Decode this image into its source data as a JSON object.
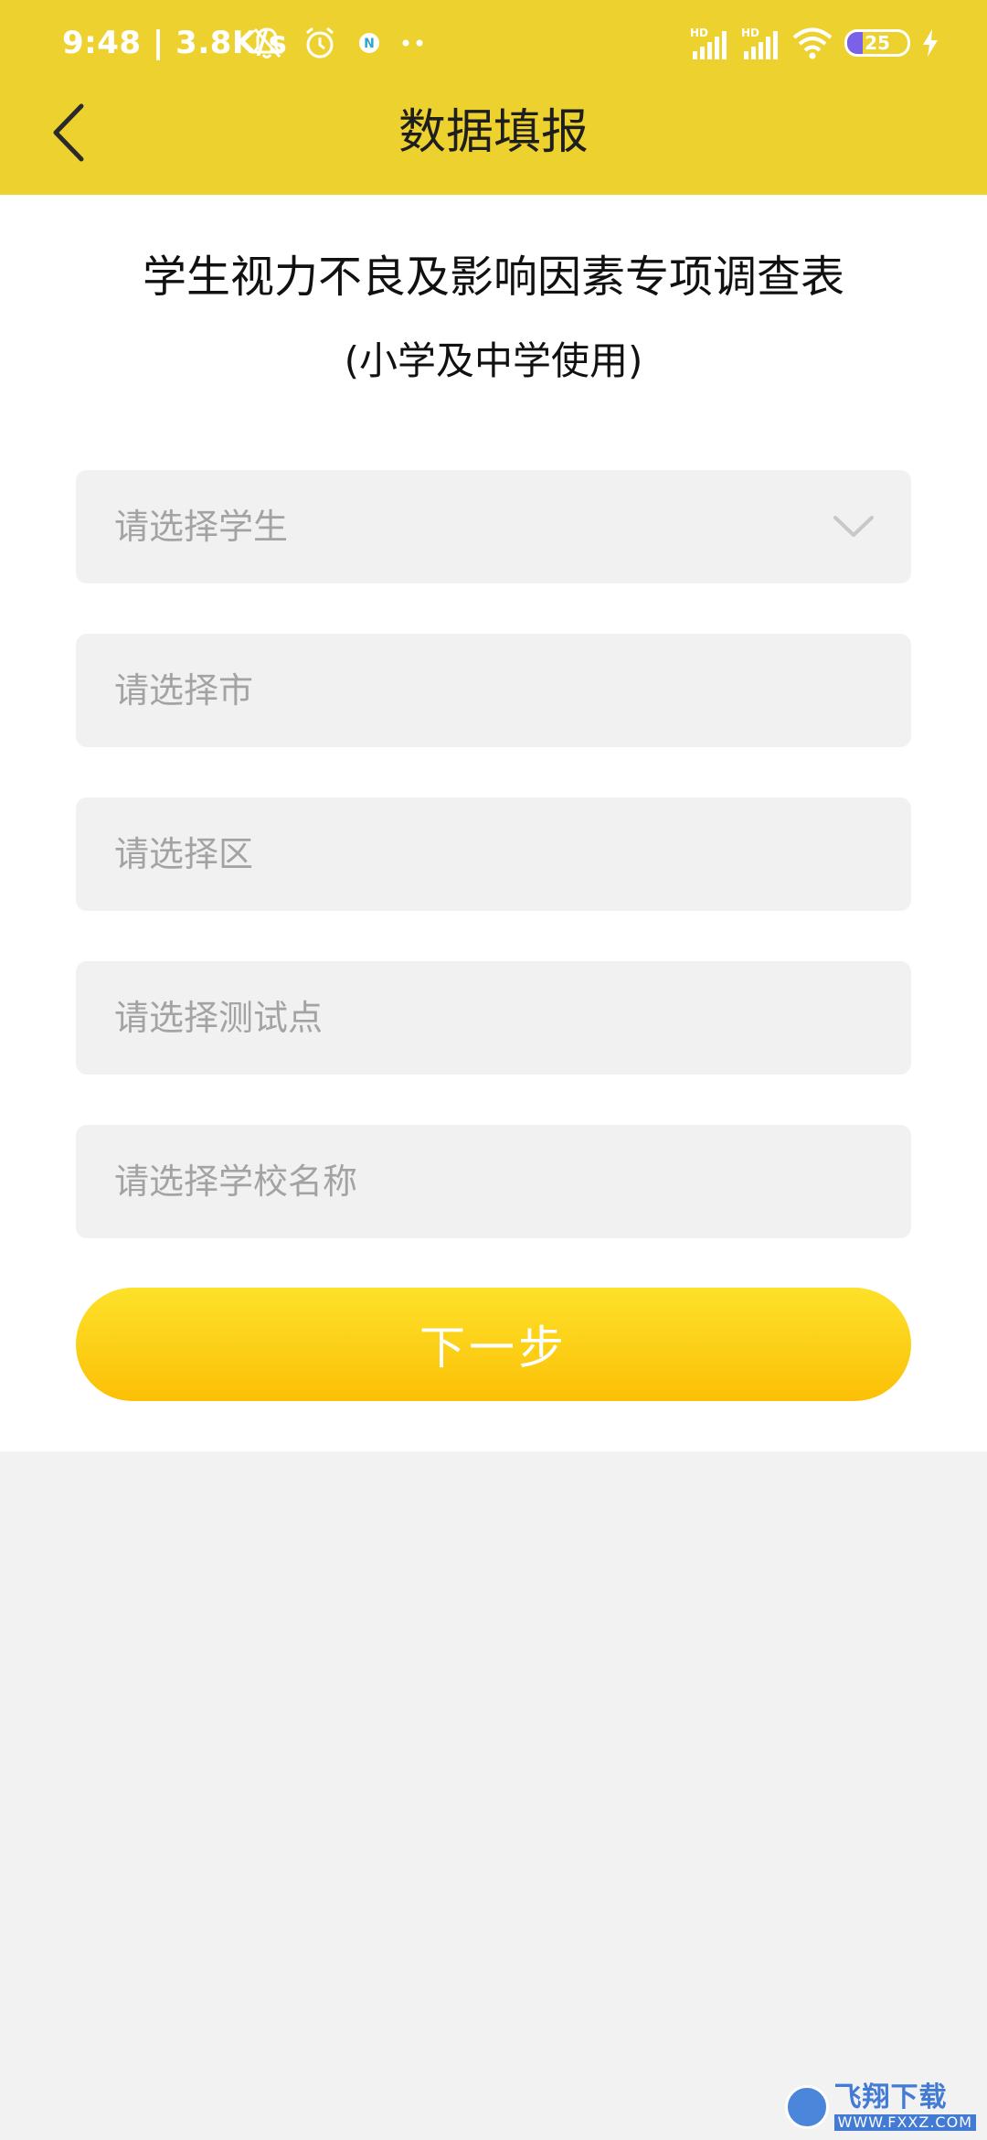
{
  "status_bar": {
    "text": "9:48 | 3.8K/s",
    "icons": [
      "bell-off-icon",
      "alarm-icon",
      "notification-n-icon",
      "more-dots-icon",
      "hd-signal-icon",
      "hd-signal-icon",
      "wifi-icon",
      "battery-icon",
      "charging-icon"
    ],
    "signal_label": "HD",
    "battery_level": "25",
    "battery_fraction": 0.25
  },
  "nav": {
    "back_icon": "chevron-left-icon",
    "title": "数据填报"
  },
  "form": {
    "title": "学生视力不良及影响因素专项调查表",
    "subtitle": "(小学及中学使用)",
    "fields": [
      {
        "placeholder": "请选择学生",
        "has_dropdown": true
      },
      {
        "placeholder": "请选择市"
      },
      {
        "placeholder": "请选择区"
      },
      {
        "placeholder": "请选择测试点"
      },
      {
        "placeholder": "请选择学校名称"
      }
    ],
    "next_label": "下一步"
  },
  "watermark": {
    "main": "飞翔下载",
    "sub": "WWW.FXXZ.COM"
  },
  "colors": {
    "header_bg": "#edd22f",
    "button_gradient_top": "#fde12a",
    "button_gradient_bottom": "#fcc007",
    "field_bg": "#f1f1f1",
    "placeholder_text": "#a3a3a3",
    "page_bg": "#f2f2f2",
    "battery_fill": "#7b61e8"
  }
}
